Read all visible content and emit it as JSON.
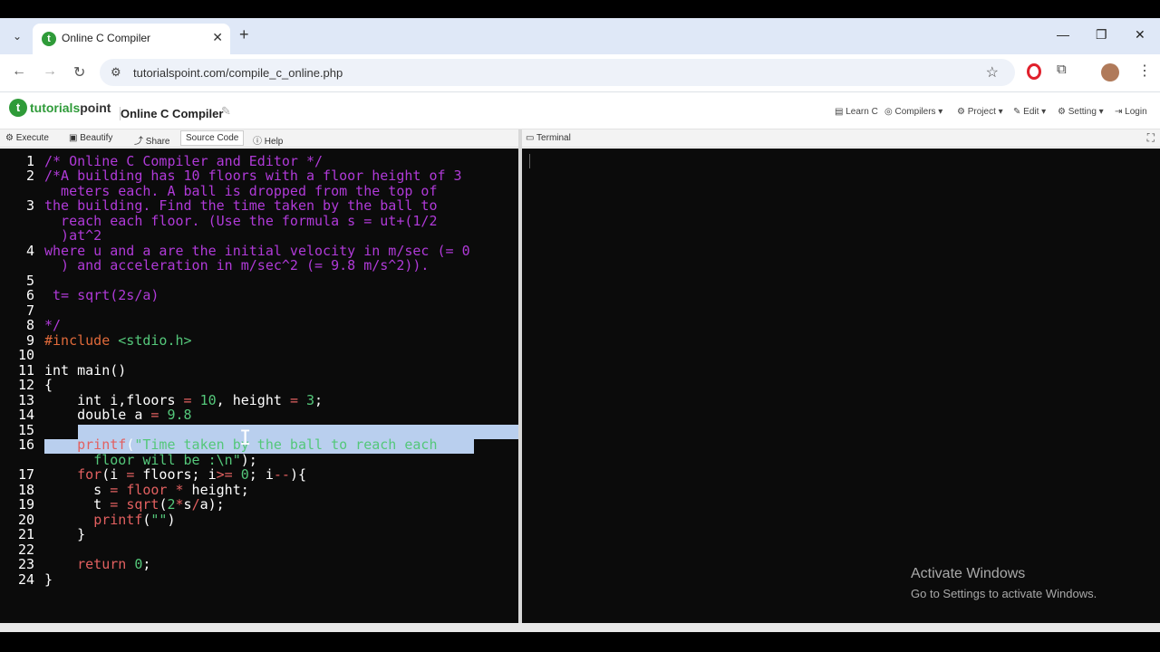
{
  "browser": {
    "tab_title": "Online C Compiler",
    "url": "tutorialspoint.com/compile_c_online.php"
  },
  "site": {
    "logo_part1": "tutorials",
    "logo_part2": "point",
    "page_title": "Online C Compiler",
    "menu": [
      "Learn C",
      "Compilers",
      "Project",
      "Edit",
      "Setting",
      "Login"
    ]
  },
  "toolbar": {
    "execute": "Execute",
    "beautify": "Beautify",
    "share": "Share",
    "source_code": "Source Code",
    "help": "Help"
  },
  "terminal": {
    "label": "Terminal"
  },
  "editor": {
    "line_numbers": [
      "1",
      "2",
      "3",
      "4",
      "5",
      "6",
      "7",
      "8",
      "9",
      "10",
      "11",
      "12",
      "13",
      "14",
      "15",
      "16",
      "17",
      "18",
      "19",
      "20",
      "21",
      "22",
      "23",
      "24"
    ]
  },
  "watermark": {
    "title": "Activate Windows",
    "subtitle": "Go to Settings to activate Windows."
  }
}
